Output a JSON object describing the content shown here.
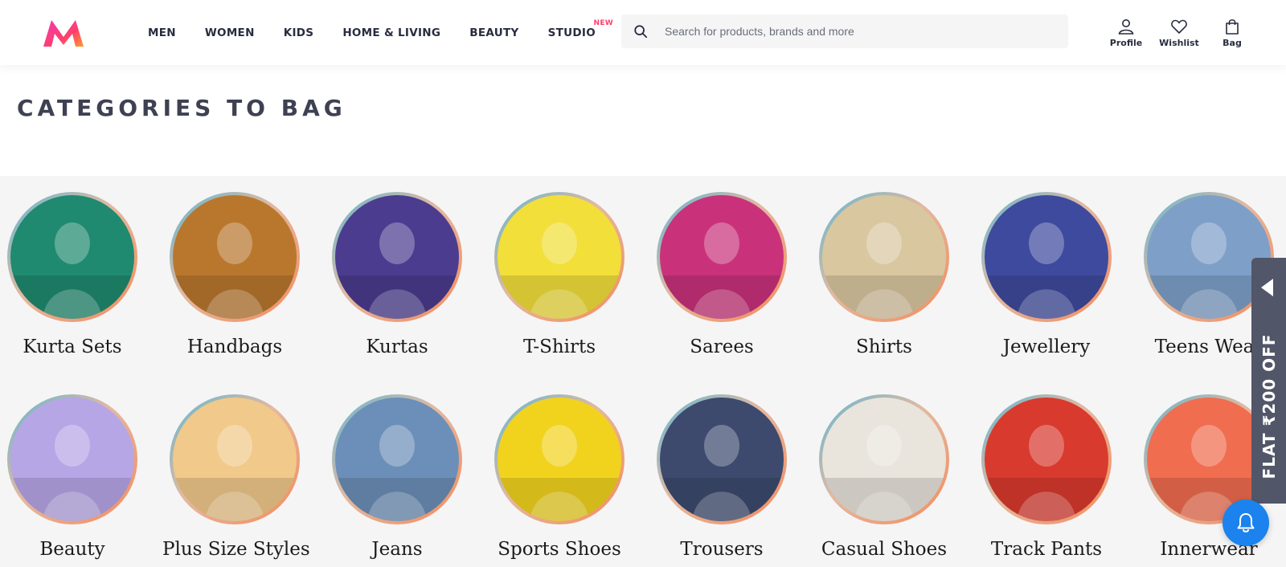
{
  "brand": {
    "logo_colors": [
      "#ff3f6c",
      "#f13ab1",
      "#ff9933"
    ]
  },
  "nav": {
    "items": [
      {
        "label": "MEN"
      },
      {
        "label": "WOMEN"
      },
      {
        "label": "KIDS"
      },
      {
        "label": "HOME & LIVING"
      },
      {
        "label": "BEAUTY"
      },
      {
        "label": "STUDIO",
        "badge": "NEW"
      }
    ]
  },
  "search": {
    "placeholder": "Search for products, brands and more",
    "value": ""
  },
  "actions": {
    "profile": "Profile",
    "wishlist": "Wishlist",
    "bag": "Bag"
  },
  "section": {
    "title": "CATEGORIES TO BAG"
  },
  "categories": [
    {
      "label": "Kurta Sets",
      "bg": "#1f8a6f"
    },
    {
      "label": "Handbags",
      "bg": "#b9772e"
    },
    {
      "label": "Kurtas",
      "bg": "#4b3c8f"
    },
    {
      "label": "T-Shirts",
      "bg": "#f2df3a"
    },
    {
      "label": "Sarees",
      "bg": "#c9327a"
    },
    {
      "label": "Shirts",
      "bg": "#d9c7a0"
    },
    {
      "label": "Jewellery",
      "bg": "#3e4a9e"
    },
    {
      "label": "Teens Wear",
      "bg": "#7ea0c8"
    },
    {
      "label": "Beauty",
      "bg": "#b7a6e6"
    },
    {
      "label": "Plus Size Styles",
      "bg": "#f1c98a"
    },
    {
      "label": "Jeans",
      "bg": "#6b8fb8"
    },
    {
      "label": "Sports Shoes",
      "bg": "#f1d31e"
    },
    {
      "label": "Trousers",
      "bg": "#3d4a6e"
    },
    {
      "label": "Casual Shoes",
      "bg": "#e9e4dc"
    },
    {
      "label": "Track Pants",
      "bg": "#d93a2e"
    },
    {
      "label": "Innerwear",
      "bg": "#f06d4f"
    }
  ],
  "offer": {
    "text": "FLAT ₹200 OFF"
  },
  "icons": {
    "search": "search-icon",
    "profile": "user-icon",
    "wishlist": "heart-icon",
    "bag": "bag-icon",
    "bell": "bell-icon",
    "arrow": "chevron-left-icon"
  },
  "colors": {
    "accent": "#ff3f6c",
    "bell": "#1b82ee",
    "offer_tab": "#525669"
  }
}
